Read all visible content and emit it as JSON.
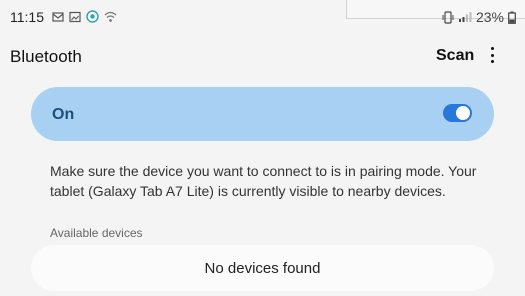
{
  "status_bar": {
    "time": "11:15",
    "battery_percent": "23%",
    "left_icons": [
      "message-icon",
      "gallery-icon",
      "shield-icon",
      "wifi-icon"
    ],
    "right_icons": [
      "vibrate-icon",
      "signal-icon",
      "battery-icon"
    ]
  },
  "header": {
    "title": "Bluetooth",
    "scan_label": "Scan"
  },
  "bluetooth": {
    "state_label": "On",
    "enabled": true,
    "accent_color": "#2778d9",
    "card_color": "#a8d0f3"
  },
  "info": {
    "line1": "Make sure the device you want to connect to is in pairing mode. Your",
    "line2": "tablet (Galaxy Tab A7 Lite) is currently visible to nearby devices."
  },
  "available": {
    "section_title": "Available devices",
    "empty_message": "No devices found"
  }
}
